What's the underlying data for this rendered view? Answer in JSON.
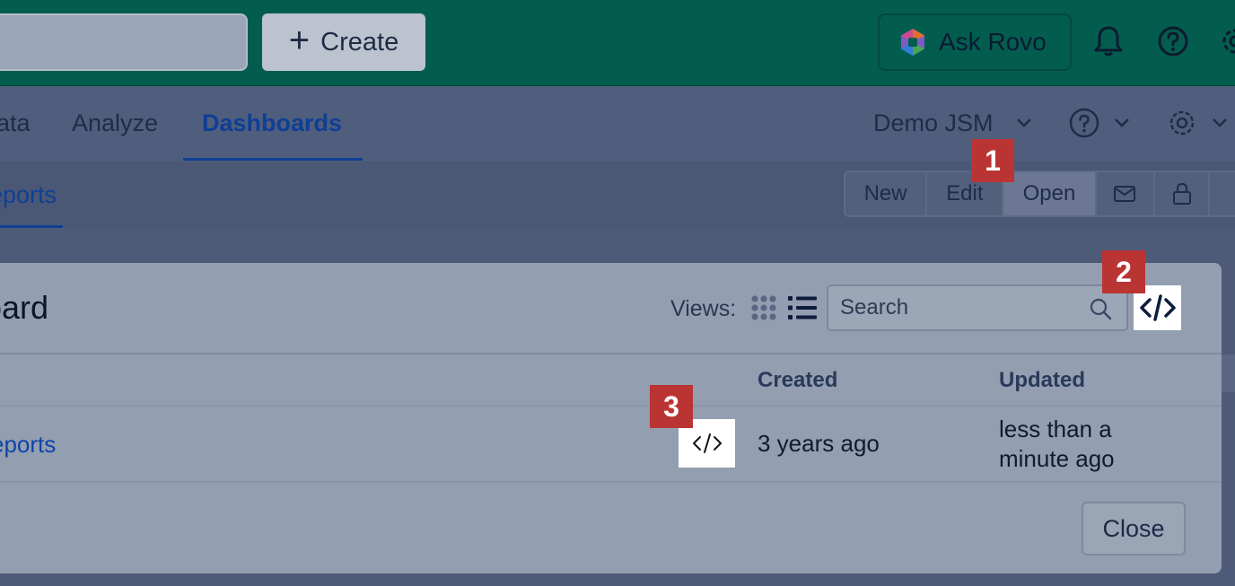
{
  "topbar": {
    "create_label": "Create",
    "create_icon": "plus-icon",
    "rovo_label": "Ask Rovo",
    "icons": [
      "rovo-logo-icon",
      "bell-icon",
      "help-icon",
      "settings-icon"
    ]
  },
  "nav": {
    "items": [
      "ata",
      "Analyze",
      "Dashboards"
    ],
    "active": "Dashboards",
    "project": "Demo JSM"
  },
  "subnav": {
    "reports_tab": "eports",
    "toolbar": [
      "New",
      "Edit",
      "Open"
    ],
    "toolbar_icons": [
      "mail-icon",
      "lock-icon"
    ]
  },
  "dialog": {
    "title": "oard",
    "views_label": "Views:",
    "search_placeholder": "Search",
    "columns": [
      "Created",
      "Updated"
    ],
    "rows": [
      {
        "name": "eports",
        "created": "3 years ago",
        "updated_line1": "less than a",
        "updated_line2": "minute ago"
      }
    ],
    "close_label": "Close"
  },
  "annotations": [
    "1",
    "2",
    "3"
  ],
  "colors": {
    "topbar": "#035d4e",
    "accent": "#0f3f95",
    "badge": "#bb3434"
  }
}
